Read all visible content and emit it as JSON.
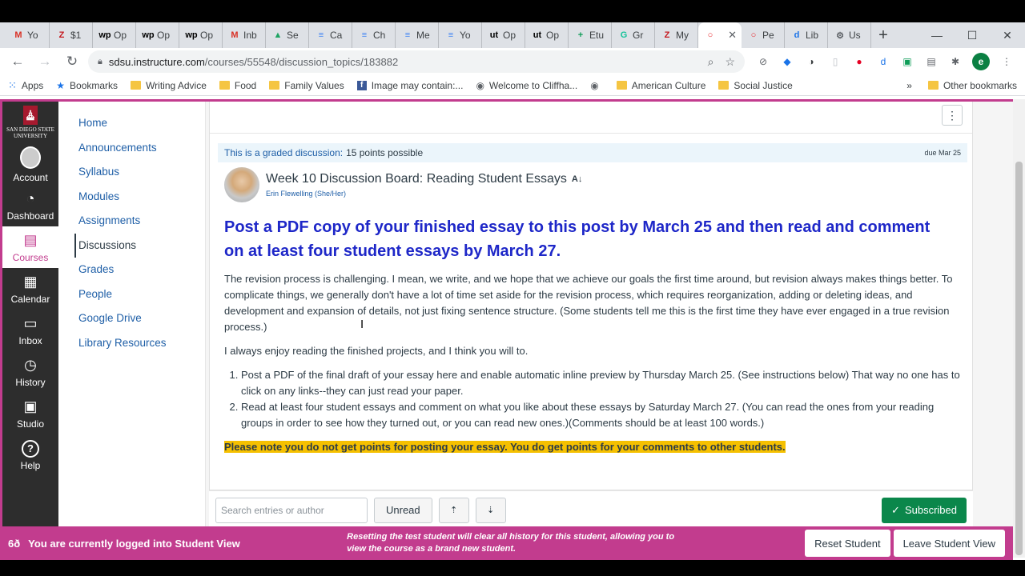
{
  "browser": {
    "tabs": [
      {
        "icon": "M",
        "color": "#d93025",
        "label": "Yo"
      },
      {
        "icon": "Z",
        "color": "#c4161c",
        "label": "$1"
      },
      {
        "icon": "wp",
        "color": "#000",
        "label": "Op"
      },
      {
        "icon": "wp",
        "color": "#000",
        "label": "Op"
      },
      {
        "icon": "wp",
        "color": "#000",
        "label": "Op"
      },
      {
        "icon": "M",
        "color": "#d93025",
        "label": "Inb"
      },
      {
        "icon": "▲",
        "color": "#1fa463",
        "label": "Se"
      },
      {
        "icon": "≡",
        "color": "#4285f4",
        "label": "Ca"
      },
      {
        "icon": "≡",
        "color": "#4285f4",
        "label": "Ch"
      },
      {
        "icon": "≡",
        "color": "#4285f4",
        "label": "Me"
      },
      {
        "icon": "≡",
        "color": "#4285f4",
        "label": "Yo"
      },
      {
        "icon": "ut",
        "color": "#000",
        "label": "Op"
      },
      {
        "icon": "ut",
        "color": "#000",
        "label": "Op"
      },
      {
        "icon": "+",
        "color": "#0f9d58",
        "label": "Etu"
      },
      {
        "icon": "G",
        "color": "#15c39a",
        "label": "Gr"
      },
      {
        "icon": "Z",
        "color": "#c4161c",
        "label": "My"
      },
      {
        "icon": "○",
        "color": "#e72429",
        "label": "",
        "active": true
      },
      {
        "icon": "○",
        "color": "#e72429",
        "label": "Pe"
      },
      {
        "icon": "d",
        "color": "#1a73e8",
        "label": "Lib"
      },
      {
        "icon": "⚙",
        "color": "#5f6368",
        "label": "Us"
      }
    ],
    "url_host": "sdsu.instructure.com",
    "url_path": "/courses/55548/discussion_topics/183882",
    "bookmarks": {
      "apps": "Apps",
      "items": [
        "Bookmarks",
        "Writing Advice",
        "Food",
        "Family Values",
        "Image may contain:...",
        "Welcome to Cliffha...",
        "",
        "American Culture",
        "Social Justice"
      ],
      "other": "Other bookmarks",
      "more": "»"
    }
  },
  "global_nav": {
    "logo_text": "San Diego State University",
    "items": [
      {
        "label": "Account",
        "icon": "account-icon"
      },
      {
        "label": "Dashboard",
        "icon": "dashboard-icon"
      },
      {
        "label": "Courses",
        "icon": "courses-icon",
        "active": true
      },
      {
        "label": "Calendar",
        "icon": "calendar-icon"
      },
      {
        "label": "Inbox",
        "icon": "inbox-icon"
      },
      {
        "label": "History",
        "icon": "history-icon"
      },
      {
        "label": "Studio",
        "icon": "studio-icon"
      },
      {
        "label": "Help",
        "icon": "help-icon"
      }
    ]
  },
  "course_nav": [
    "Home",
    "Announcements",
    "Syllabus",
    "Modules",
    "Assignments",
    "Discussions",
    "Grades",
    "People",
    "Google Drive",
    "Library Resources"
  ],
  "discussion": {
    "graded_label": "This is a graded discussion:",
    "points": "15 points possible",
    "due": "due Mar 25",
    "title": "Week 10 Discussion Board: Reading Student Essays",
    "author": "Erin Flewelling (She/Her)",
    "headline": "Post a PDF copy of your finished essay to this post by March 25 and then read and comment on at least four student essays by March 27.",
    "para1": "The revision process is challenging. I mean, we write, and we hope that we achieve our goals the first time around, but revision always makes things better. To complicate things, we generally don't have a lot of time set aside for the revision process, which requires reorganization, adding or deleting ideas, and development and expansion of details, not just fixing sentence structure. (Some students tell me this is the first time they have ever engaged in a true revision process.)",
    "para2": "I always enjoy reading the finished projects, and I think you will to.",
    "list": [
      "Post a PDF of the final draft of your essay here and enable automatic inline preview by Thursday March 25. (See instructions below) That way no one has to click on any links--they can just read your paper.",
      "Read at least four student essays and comment on what you like about these essays by Saturday March 27.  (You can read the ones from your reading groups in order to see how they turned out, or you can read new ones.)(Comments should be at least 100 words.)"
    ],
    "note": "Please note you do not get points for posting your essay. You do get points for your comments to other students."
  },
  "bottom_bar": {
    "search_placeholder": "Search entries or author",
    "unread": "Unread",
    "subscribed": "Subscribed"
  },
  "student_view": {
    "icon_text": "6ð",
    "message": "You are currently logged into Student View",
    "reset_note": "Resetting the test student will clear all history for this student, allowing you to view the course as a brand new student.",
    "reset_button": "Reset Student",
    "leave_button": "Leave Student View"
  }
}
